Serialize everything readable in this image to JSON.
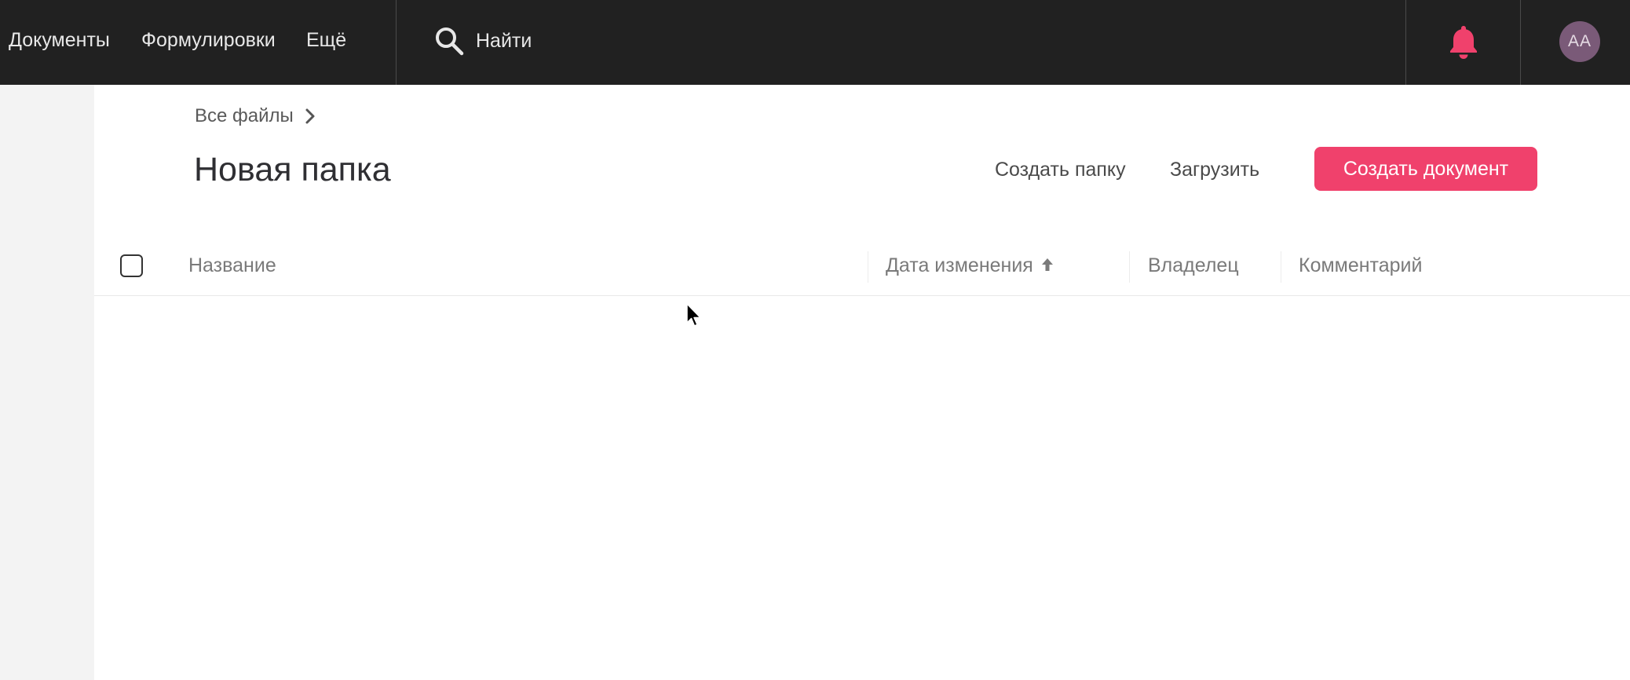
{
  "topbar": {
    "nav_items": [
      "Документы",
      "Формулировки",
      "Ещё"
    ],
    "search_label": "Найти",
    "avatar_initials": "AA",
    "icons": {
      "search": "search-icon",
      "notifications": "bell-icon"
    },
    "colors": {
      "background": "#212121",
      "bell": "#f0416c",
      "avatar": "#7a5a78"
    }
  },
  "breadcrumb": {
    "label": "Все файлы",
    "icon": "chevron-right-icon"
  },
  "page": {
    "title": "Новая папка"
  },
  "actions": {
    "create_folder": "Создать папку",
    "upload": "Загрузить",
    "create_document": "Создать документ",
    "accent_color": "#f0416c"
  },
  "table": {
    "columns": {
      "name": "Название",
      "modified": "Дата изменения",
      "owner": "Владелец",
      "comment": "Комментарий"
    },
    "sort": {
      "column": "modified",
      "direction": "ascending",
      "icon": "arrow-up-icon"
    },
    "rows": []
  }
}
